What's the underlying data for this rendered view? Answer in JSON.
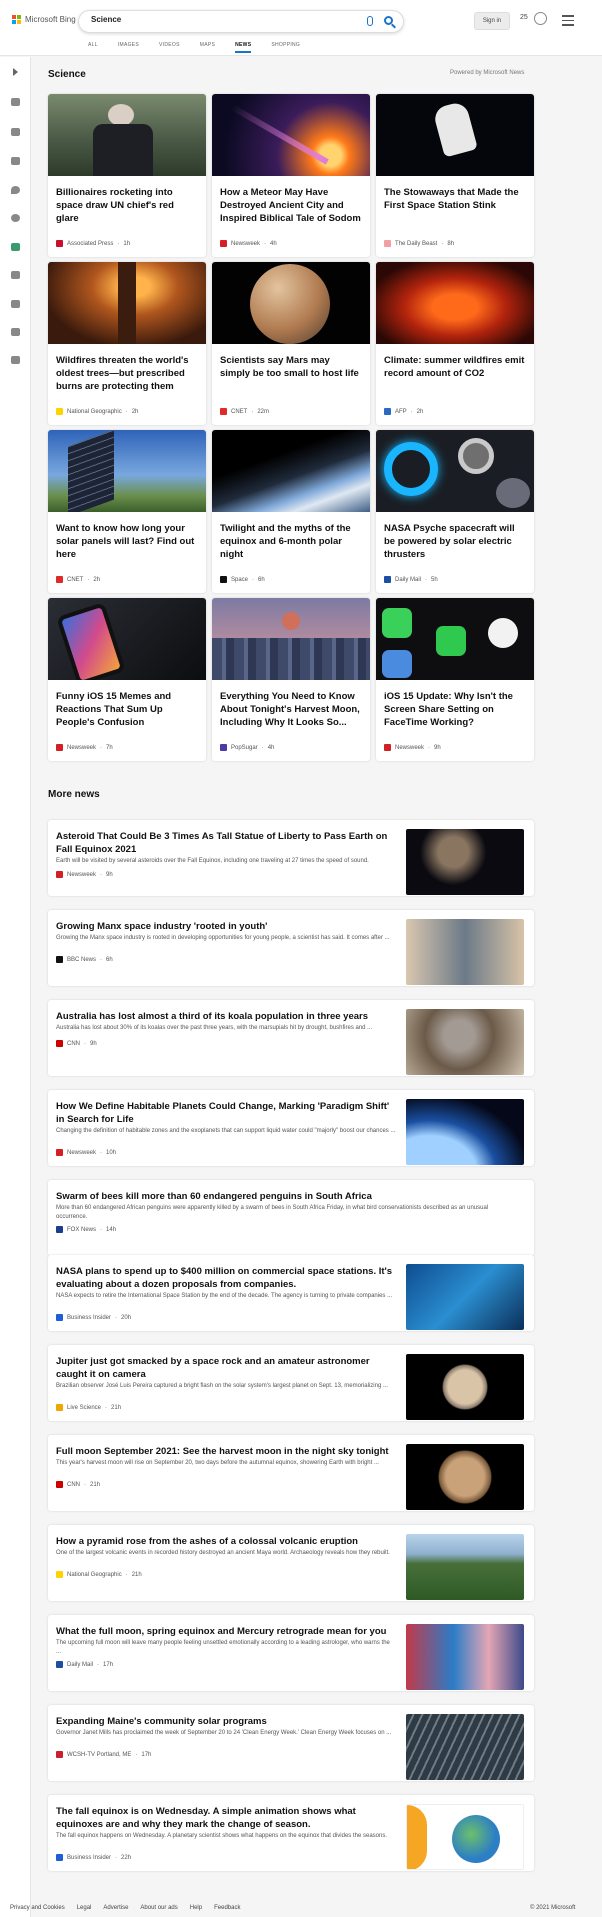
{
  "header": {
    "brand": "Microsoft Bing",
    "search_value": "Science",
    "signin_label": "Sign in",
    "rewards_count": "25",
    "tabs": [
      "ALL",
      "IMAGES",
      "VIDEOS",
      "MAPS",
      "NEWS",
      "SHOPPING"
    ],
    "active_tab": "NEWS"
  },
  "rail": {
    "icons": [
      "expand-icon",
      "home-icon",
      "tools-icon",
      "flag-icon",
      "location-icon",
      "globe-icon",
      "science-icon",
      "rocket-icon",
      "entertainment-icon",
      "bank-icon",
      "card-icon"
    ]
  },
  "science": {
    "heading": "Science",
    "powered_by": "Powered by Microsoft News",
    "cards": [
      {
        "title": "Billionaires rocketing into space draw UN chief's red glare",
        "source": "Associated Press",
        "age": "1h"
      },
      {
        "title": "How a Meteor May Have Destroyed Ancient City and Inspired Biblical Tale of Sodom",
        "source": "Newsweek",
        "age": "4h"
      },
      {
        "title": "The Stowaways that Made the First Space Station Stink",
        "source": "The Daily Beast",
        "age": "8h"
      },
      {
        "title": "Wildfires threaten the world's oldest trees—but prescribed burns are protecting them",
        "source": "National Geographic",
        "age": "2h"
      },
      {
        "title": "Scientists say Mars may simply be too small to host life",
        "source": "CNET",
        "age": "22m"
      },
      {
        "title": "Climate: summer wildfires emit record amount of CO2",
        "source": "AFP",
        "age": "2h"
      },
      {
        "title": "Want to know how long your solar panels will last? Find out here",
        "source": "CNET",
        "age": "2h"
      },
      {
        "title": "Twilight and the myths of the equinox and 6-month polar night",
        "source": "Space",
        "age": "6h"
      },
      {
        "title": "NASA Psyche spacecraft will be powered by solar electric thrusters",
        "source": "Daily Mail",
        "age": "5h"
      },
      {
        "title": "Funny iOS 15 Memes and Reactions That Sum Up People's Confusion",
        "source": "Newsweek",
        "age": "7h"
      },
      {
        "title": "Everything You Need to Know About Tonight's Harvest Moon, Including Why It Looks So...",
        "source": "PopSugar",
        "age": "4h"
      },
      {
        "title": "iOS 15 Update: Why Isn't the Screen Share Setting on FaceTime Working?",
        "source": "Newsweek",
        "age": "9h"
      }
    ]
  },
  "more_news": {
    "heading": "More news",
    "items": [
      {
        "title": "Asteroid That Could Be 3 Times As Tall Statue of Liberty to Pass Earth on Fall Equinox 2021",
        "snippet": "Earth will be visited by several asteroids over the Fall Equinox, including one traveling at 27 times the speed of sound.",
        "source": "Newsweek",
        "age": "9h"
      },
      {
        "title": "Growing Manx space industry 'rooted in youth'",
        "snippet": "Growing the Manx space industry is rooted in developing opportunities for young people, a scientist has said. It comes after ...",
        "source": "BBC News",
        "age": "6h"
      },
      {
        "title": "Australia has lost almost a third of its koala population in three years",
        "snippet": "Australia has lost about 30% of its koalas over the past three years, with the marsupials hit by drought, bushfires and ...",
        "source": "CNN",
        "age": "9h"
      },
      {
        "title": "How We Define Habitable Planets Could Change, Marking 'Paradigm Shift' in Search for Life",
        "snippet": "Changing the definition of habitable zones and the exoplanets that can support liquid water could \"majorly\" boost our chances ...",
        "source": "Newsweek",
        "age": "10h"
      },
      {
        "title": "Swarm of bees kill more than 60 endangered penguins in South Africa",
        "snippet": "More than 60 endangered African penguins were apparently killed by a swarm of bees in South Africa Friday, in what bird conservationists described as an unusual occurrence.",
        "source": "FOX News",
        "age": "14h"
      },
      {
        "title": "NASA plans to spend up to $400 million on commercial space stations. It's evaluating about a dozen proposals from companies.",
        "snippet": "NASA expects to retire the International Space Station by the end of the decade. The agency is turning to private companies ...",
        "source": "Business Insider",
        "age": "20h"
      },
      {
        "title": "Jupiter just got smacked by a space rock and an amateur astronomer caught it on camera",
        "snippet": "Brazilian observer José Luis Pereira captured a bright flash on the solar system's largest planet on Sept. 13, memorializing ...",
        "source": "Live Science",
        "age": "21h"
      },
      {
        "title": "Full moon September 2021: See the harvest moon in the night sky tonight",
        "snippet": "This year's harvest moon will rise on September 20, two days before the autumnal equinox, showering Earth with bright ...",
        "source": "CNN",
        "age": "21h"
      },
      {
        "title": "How a pyramid rose from the ashes of a colossal volcanic eruption",
        "snippet": "One of the largest volcanic events in recorded history destroyed an ancient Maya world. Archaeology reveals how they rebuilt.",
        "source": "National Geographic",
        "age": "21h"
      },
      {
        "title": "What the full moon, spring equinox and Mercury retrograde mean for you",
        "snippet": "The upcoming full moon will leave many people feeling unsettled emotionally according to a leading astrologer, who warns the ...",
        "source": "Daily Mail",
        "age": "17h"
      },
      {
        "title": "Expanding Maine's community solar programs",
        "snippet": "Governor Janet Mills has proclaimed the week of September 20 to 24 'Clean Energy Week.' Clean Energy Week focuses on ...",
        "source": "WCSH-TV Portland, ME",
        "age": "17h"
      },
      {
        "title": "The fall equinox is on Wednesday. A simple animation shows what equinoxes are and why they mark the change of season.",
        "snippet": "The fall equinox happens on Wednesday. A planetary scientist shows what happens on the equinox that divides the seasons.",
        "source": "Business Insider",
        "age": "22h"
      }
    ]
  },
  "footer": {
    "links": [
      "Privacy and Cookies",
      "Legal",
      "Advertise",
      "About our ads",
      "Help",
      "Feedback"
    ],
    "copyright": "© 2021 Microsoft"
  },
  "colors": {
    "accent": "#1a73c7",
    "page_bg": "#f5f5f5"
  }
}
